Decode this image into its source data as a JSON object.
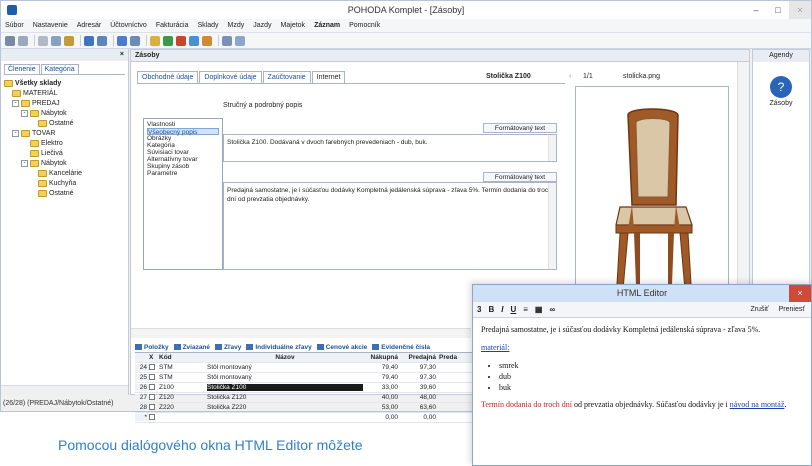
{
  "window": {
    "title": "POHODA Komplet - [Zásoby]"
  },
  "menu": [
    "Súbor",
    "Nastavenie",
    "Adresár",
    "Účtovníctvo",
    "Fakturácia",
    "Sklady",
    "Mzdy",
    "Jazdy",
    "Majetok",
    "Záznam",
    "Pomocník"
  ],
  "left": {
    "header_close": "×",
    "tabs": [
      "Členenie",
      "Kategória"
    ],
    "tree": [
      {
        "label": "Všetky sklady",
        "level": 0,
        "bold": true
      },
      {
        "label": "MATERIÁL",
        "level": 1
      },
      {
        "label": "PREDAJ",
        "level": 1
      },
      {
        "label": "Nábytok",
        "level": 2
      },
      {
        "label": "Ostatné",
        "level": 3
      },
      {
        "label": "TOVAR",
        "level": 1
      },
      {
        "label": "Elektro",
        "level": 2
      },
      {
        "label": "Liečivá",
        "level": 2
      },
      {
        "label": "Nábytok",
        "level": 2
      },
      {
        "label": "Kancelárie",
        "level": 3
      },
      {
        "label": "Kuchyňa",
        "level": 3
      },
      {
        "label": "Ostatné",
        "level": 3
      }
    ]
  },
  "status": "(26/28) (PREDAJ/Nábytok/Ostatné)",
  "main": {
    "header": "Zásoby",
    "tabs": [
      "Obchodné údaje",
      "Doplnkové údaje",
      "Zaúčtovanie",
      "Internet"
    ],
    "product_title": "Stolička Z100",
    "short_desc_label": "Stručný a podrobný popis",
    "list_items": [
      "Vlastnosti",
      "Všeobecný popis",
      "Obrázky",
      "Kategória",
      "Súvisiaci tovar",
      "Alternatívny tovar",
      "Skupiny zásob",
      "Parametre"
    ],
    "format_button": "Formátovaný text",
    "short_text": "Stolička Z100. Dodávaná v dvoch farebných prevedeniach - dub, buk.",
    "long_text": "Predajná samostatne, je i súčasťou dodávky Kompletná jedálenská súprava - zľava 5%. Termín dodania do troch dní od prevzatia objednávky.",
    "image_counter": "1/1",
    "image_name": "stolicka.png"
  },
  "grid": {
    "tabs": [
      "Položky",
      "Zviazané",
      "Zľavy",
      "Individuálne zľavy",
      "Cenové akcie",
      "Evidenčné čísla"
    ],
    "headers": {
      "x": "X",
      "kod": "Kód",
      "nazov": "Názov",
      "nakupna": "Nákupná",
      "predajna": "Predajná",
      "pred2": "Preda"
    },
    "rows": [
      {
        "idx": "24",
        "kod": "STM",
        "nazov": "Stôl montovaný",
        "nakupna": "79,40",
        "predajna": "97,30"
      },
      {
        "idx": "25",
        "kod": "STM",
        "nazov": "Stôl montovaný",
        "nakupna": "79,40",
        "predajna": "97,30"
      },
      {
        "idx": "26",
        "kod": "Z100",
        "nazov": "Stolička Z100",
        "nakupna": "33,00",
        "predajna": "39,60"
      },
      {
        "idx": "27",
        "kod": "Z120",
        "nazov": "Stolička Z120",
        "nakupna": "40,00",
        "predajna": "48,00"
      },
      {
        "idx": "28",
        "kod": "Z220",
        "nazov": "Stolička Z220",
        "nakupna": "53,00",
        "predajna": "63,60"
      },
      {
        "idx": "*",
        "kod": "",
        "nazov": "",
        "nakupna": "0,00",
        "predajna": "0,00"
      }
    ]
  },
  "agendy": {
    "header": "Agendy",
    "label": "Zásoby"
  },
  "html_editor": {
    "title": "HTML Editor",
    "size": "3",
    "cancel": "Zrušiť",
    "move": "Preniesť",
    "p1": "Predajná samostatne, je i súčasťou dodávky Kompletná jedálenská súprava - zľava 5%.",
    "material_label": "materiál:",
    "bullets": [
      "smrek",
      "dub",
      "buk"
    ],
    "p2_red": "Termín dodania do troch dní",
    "p2_rest": " od prevzatia objednávky. Súčasťou dodávky je i ",
    "p2_link": "návod na montáž",
    "p2_end": "."
  },
  "caption": "Pomocou dialógového okna HTML Editor môžete"
}
